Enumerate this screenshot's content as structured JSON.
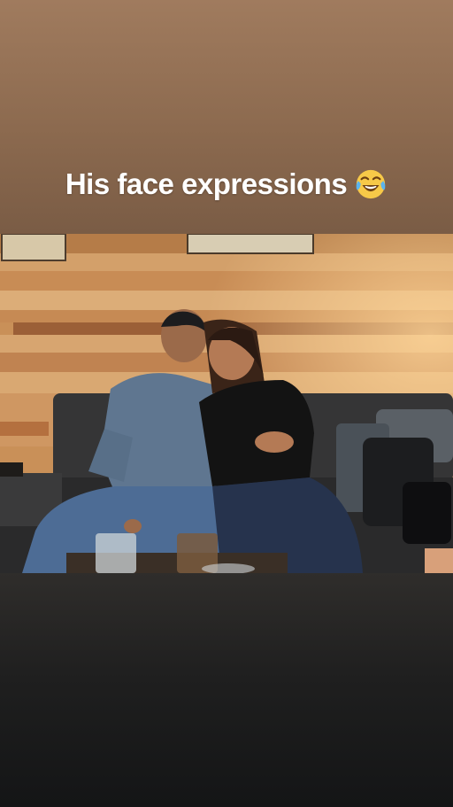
{
  "story": {
    "caption": {
      "text": "His face expressions",
      "emoji": "face-with-tears-of-joy-icon"
    },
    "photo": {
      "subject": "couple-on-sofa"
    },
    "colors": {
      "top_background": "#8c6a4f",
      "bottom_background": "#1a1b1c",
      "caption_text": "#ffffff"
    }
  }
}
